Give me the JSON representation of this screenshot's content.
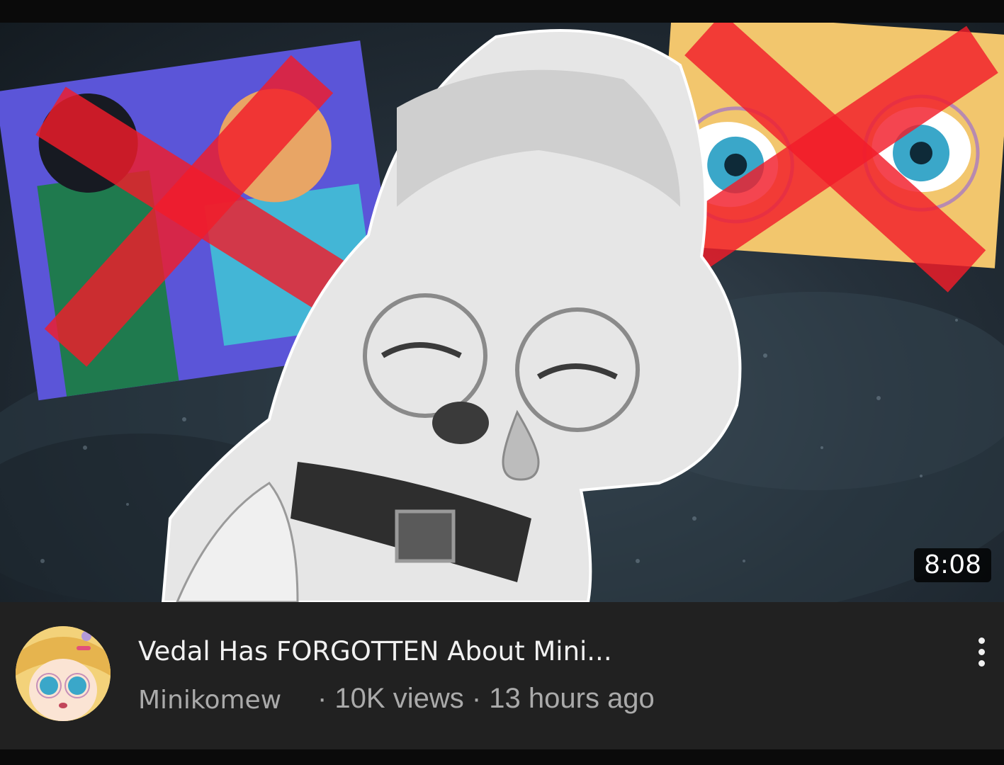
{
  "video": {
    "duration": "8:08",
    "title": "Vedal Has FORGOTTEN About Mini...",
    "channel": "Minikomew",
    "stats": "· 10K views · 13 hours ago"
  },
  "icons": {
    "more": "more-vert-icon"
  },
  "colors": {
    "background": "#0f0f0f",
    "meta_panel": "#212121",
    "title_text": "#f1f1f1",
    "secondary_text": "#aaaaaa",
    "cross_red": "#f21c2a"
  }
}
